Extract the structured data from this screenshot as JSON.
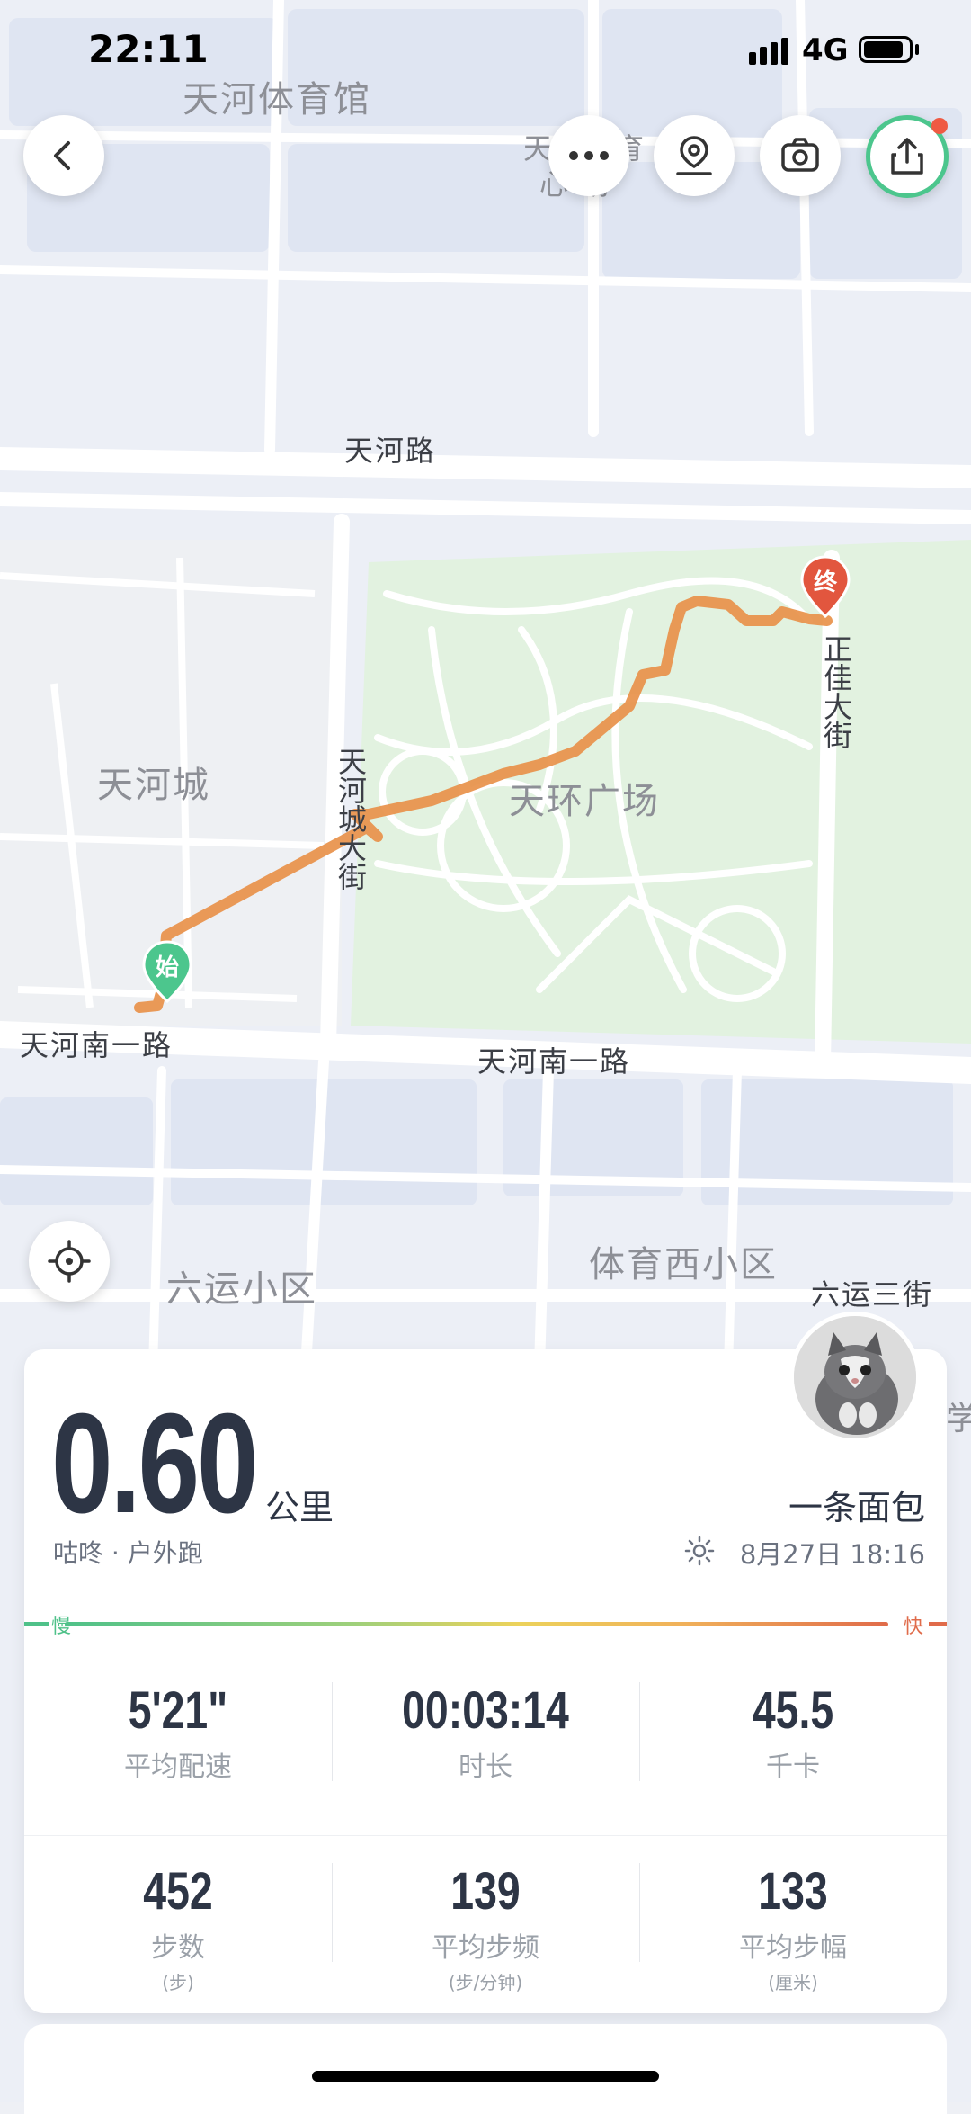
{
  "status_bar": {
    "time": "22:11",
    "network": "4G"
  },
  "map": {
    "labels": {
      "stadium": "天河体育馆",
      "stadium_center_a": "天河体育",
      "stadium_center_b": "心  场",
      "tianhe_road": "天河路",
      "tianhe_city": "天河城",
      "tianhuan_square": "天环广场",
      "tianhecheng_street": "天河城大街",
      "zhengjia_street": "正佳大街",
      "south_road_left": "天河南一路",
      "south_road_center": "天河南一路",
      "liuyun": "六运小区",
      "tiyuxi": "体育西小区",
      "liuyun_third": "六运三街",
      "edge_char": "学"
    },
    "start_pin": "始",
    "end_pin": "终"
  },
  "toolbar": {
    "back_icon": "chevron-left-icon",
    "more_icon": "more-icon",
    "location_icon": "map-pin-icon",
    "camera_icon": "camera-icon",
    "share_icon": "share-icon"
  },
  "summary": {
    "distance": "0.60",
    "unit": "公里",
    "subtitle": "咕咚 · 户外跑",
    "username": "一条面包",
    "datetime": "8月27日 18:16",
    "pace_slow": "慢",
    "pace_fast": "快"
  },
  "stats": [
    {
      "value": "5'21\"",
      "label": "平均配速",
      "sub": ""
    },
    {
      "value": "00:03:14",
      "label": "时长",
      "sub": ""
    },
    {
      "value": "45.5",
      "label": "千卡",
      "sub": ""
    },
    {
      "value": "452",
      "label": "步数",
      "sub": "(步)"
    },
    {
      "value": "139",
      "label": "平均步频",
      "sub": "(步/分钟)"
    },
    {
      "value": "133",
      "label": "平均步幅",
      "sub": "(厘米)"
    }
  ],
  "colors": {
    "route": "#e8914a",
    "start": "#4cc68d",
    "end": "#e2563e",
    "park": "#e4f3e3"
  }
}
